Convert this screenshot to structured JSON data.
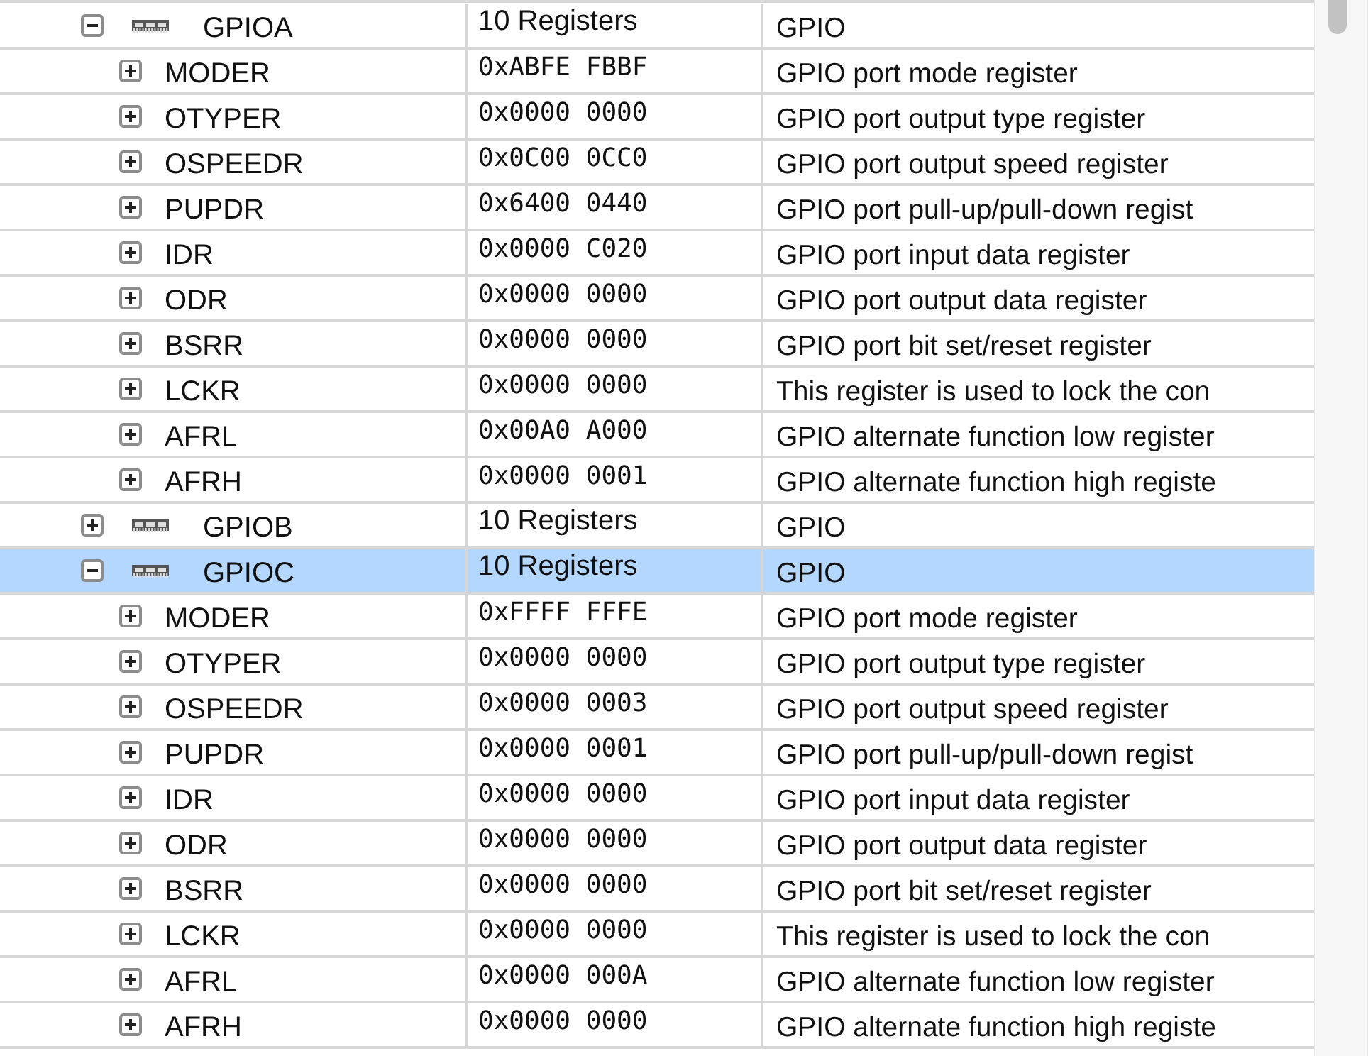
{
  "groups": [
    {
      "name": "GPIOA",
      "value": "10 Registers",
      "description": "GPIO",
      "expanded": true,
      "selected": false,
      "children": [
        {
          "name": "MODER",
          "value": "0xABFE FBBF",
          "description": "GPIO port mode register",
          "expanded": false,
          "selected": false
        },
        {
          "name": "OTYPER",
          "value": "0x0000 0000",
          "description": "GPIO port output type register",
          "expanded": false,
          "selected": false
        },
        {
          "name": "OSPEEDR",
          "value": "0x0C00 0CC0",
          "description": "GPIO port output speed register",
          "expanded": false,
          "selected": false
        },
        {
          "name": "PUPDR",
          "value": "0x6400 0440",
          "description": "GPIO port pull-up/pull-down regist",
          "expanded": false,
          "selected": false
        },
        {
          "name": "IDR",
          "value": "0x0000 C020",
          "description": "GPIO port input data register",
          "expanded": false,
          "selected": false
        },
        {
          "name": "ODR",
          "value": "0x0000 0000",
          "description": "GPIO port output data register",
          "expanded": false,
          "selected": false
        },
        {
          "name": "BSRR",
          "value": "0x0000 0000",
          "description": "GPIO port bit set/reset register",
          "expanded": false,
          "selected": false
        },
        {
          "name": "LCKR",
          "value": "0x0000 0000",
          "description": "This register is used to lock the con",
          "expanded": false,
          "selected": false
        },
        {
          "name": "AFRL",
          "value": "0x00A0 A000",
          "description": "GPIO alternate function low register",
          "expanded": false,
          "selected": false
        },
        {
          "name": "AFRH",
          "value": "0x0000 0001",
          "description": "GPIO alternate function high registe",
          "expanded": false,
          "selected": false
        }
      ]
    },
    {
      "name": "GPIOB",
      "value": "10 Registers",
      "description": "GPIO",
      "expanded": false,
      "selected": false
    },
    {
      "name": "GPIOC",
      "value": "10 Registers",
      "description": "GPIO",
      "expanded": true,
      "selected": true,
      "children": [
        {
          "name": "MODER",
          "value": "0xFFFF FFFE",
          "description": "GPIO port mode register",
          "expanded": false,
          "selected": false
        },
        {
          "name": "OTYPER",
          "value": "0x0000 0000",
          "description": "GPIO port output type register",
          "expanded": false,
          "selected": false
        },
        {
          "name": "OSPEEDR",
          "value": "0x0000 0003",
          "description": "GPIO port output speed register",
          "expanded": false,
          "selected": false
        },
        {
          "name": "PUPDR",
          "value": "0x0000 0001",
          "description": "GPIO port pull-up/pull-down regist",
          "expanded": false,
          "selected": false
        },
        {
          "name": "IDR",
          "value": "0x0000 0000",
          "description": "GPIO port input data register",
          "expanded": false,
          "selected": false
        },
        {
          "name": "ODR",
          "value": "0x0000 0000",
          "description": "GPIO port output data register",
          "expanded": false,
          "selected": false
        },
        {
          "name": "BSRR",
          "value": "0x0000 0000",
          "description": "GPIO port bit set/reset register",
          "expanded": false,
          "selected": false
        },
        {
          "name": "LCKR",
          "value": "0x0000 0000",
          "description": "This register is used to lock the con",
          "expanded": false,
          "selected": false
        },
        {
          "name": "AFRL",
          "value": "0x0000 000A",
          "description": "GPIO alternate function low register",
          "expanded": false,
          "selected": false
        },
        {
          "name": "AFRH",
          "value": "0x0000 0000",
          "description": "GPIO alternate function high registe",
          "expanded": false,
          "selected": false
        }
      ]
    }
  ]
}
